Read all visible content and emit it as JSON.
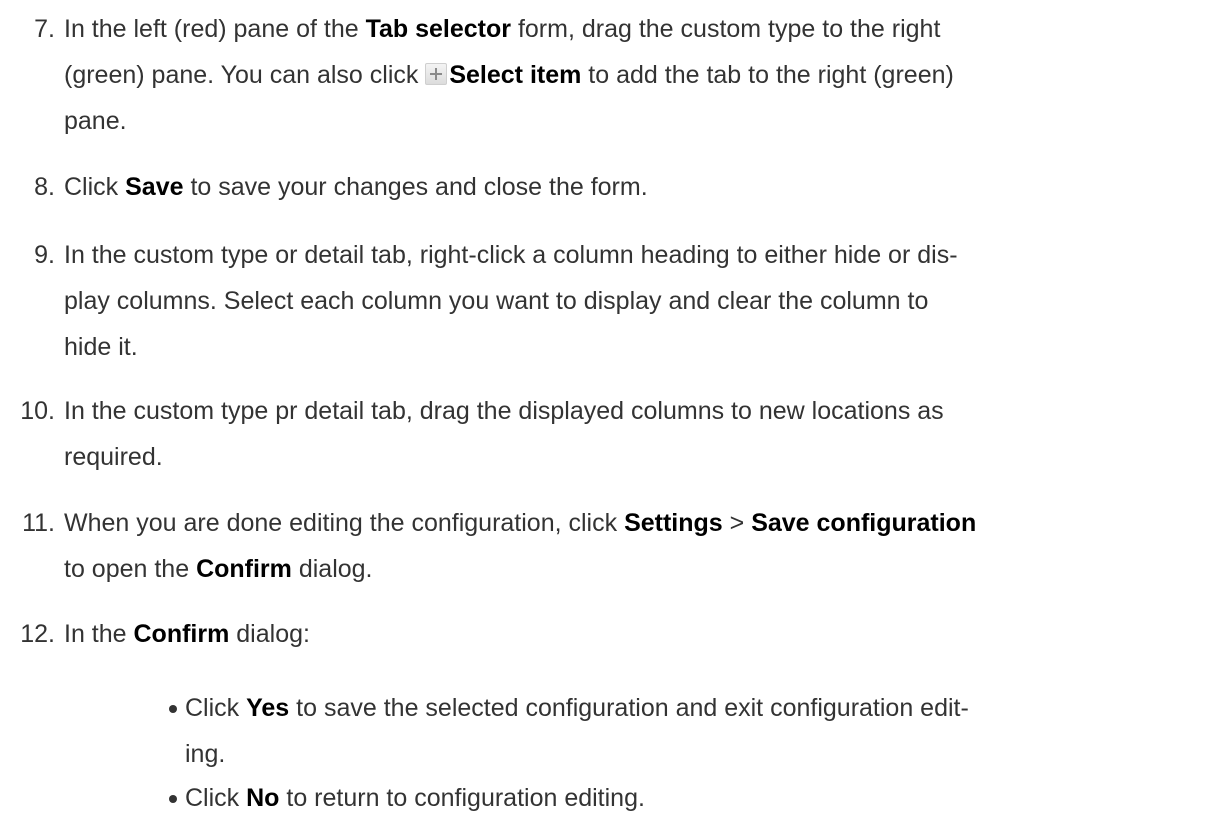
{
  "steps": [
    {
      "number": "7.",
      "line1_a": "In the left (red) pane of the ",
      "line1_b": "Tab selector",
      "line1_c": " form, drag the custom type to the right",
      "line2_a": "(green) pane. You can also click ",
      "line2_b": "Select item",
      "line2_c": " to add the tab to the right (green)",
      "line3": "pane."
    },
    {
      "number": "8.",
      "text_a": "Click ",
      "text_b": "Save",
      "text_c": " to save your changes and close the form."
    },
    {
      "number": "9.",
      "line1": "In the custom type or detail tab, right-click a column heading to either hide or dis-",
      "line2": "play columns. Select each column you want to display and clear the column to",
      "line3": "hide it."
    },
    {
      "number": "10.",
      "line1": "In the custom type pr detail tab, drag the displayed columns to new locations as",
      "line2": "required."
    },
    {
      "number": "11.",
      "line1_a": "When you are done editing the configuration, click ",
      "line1_b": "Settings",
      "line1_c": " > ",
      "line1_d": "Save configuration",
      "line2_a": "to open the ",
      "line2_b": "Confirm",
      "line2_c": " dialog."
    },
    {
      "number": "12.",
      "text_a": "In the ",
      "text_b": "Confirm",
      "text_c": " dialog:"
    }
  ],
  "bullets": [
    {
      "line1_a": "Click ",
      "line1_b": "Yes",
      "line1_c": " to save the selected configuration and exit configuration edit-",
      "line2": "ing."
    },
    {
      "text_a": "Click ",
      "text_b": "No",
      "text_c": " to return to configuration editing."
    }
  ],
  "icons": {
    "select_item": "plus-icon"
  }
}
